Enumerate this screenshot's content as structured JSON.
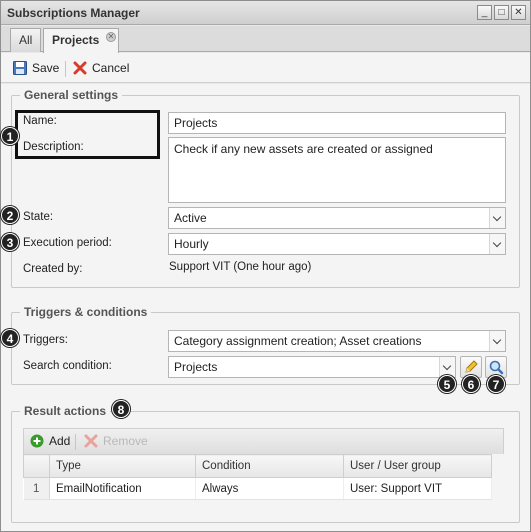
{
  "window": {
    "title": "Subscriptions Manager",
    "controls": {
      "minimize": "_",
      "maximize": "□",
      "close": "✕"
    }
  },
  "tabs": [
    {
      "label": "All",
      "active": false
    },
    {
      "label": "Projects",
      "active": true,
      "close": "✕"
    }
  ],
  "toolbar": {
    "save_label": "Save",
    "cancel_label": "Cancel"
  },
  "general": {
    "legend": "General settings",
    "name_label": "Name:",
    "name_value": "Projects",
    "description_label": "Description:",
    "description_value": "Check if any new assets are created or assigned",
    "state_label": "State:",
    "state_value": "Active",
    "period_label": "Execution period:",
    "period_value": "Hourly",
    "created_label": "Created by:",
    "created_value": "Support VIT (One hour ago)"
  },
  "triggers": {
    "legend": "Triggers & conditions",
    "triggers_label": "Triggers:",
    "triggers_value": "Category assignment creation; Asset creations",
    "search_label": "Search condition:",
    "search_value": "Projects"
  },
  "results": {
    "legend": "Result actions",
    "add_label": "Add",
    "remove_label": "Remove",
    "columns": [
      "Type",
      "Condition",
      "User / User group"
    ],
    "rows": [
      {
        "num": "1",
        "type": "EmailNotification",
        "condition": "Always",
        "user": "User: Support VIT"
      }
    ]
  },
  "callouts": [
    "1",
    "2",
    "3",
    "4",
    "5",
    "6",
    "7",
    "8"
  ],
  "colors": {
    "accent_green": "#3a9a2b",
    "delete_red": "#d83b2b",
    "callout": "#222222"
  },
  "icons": {
    "save": "floppy-disk-icon",
    "cancel": "red-x-icon",
    "add": "green-plus-icon",
    "remove": "red-x-icon",
    "edit": "pencil-icon",
    "search": "magnifier-icon"
  }
}
